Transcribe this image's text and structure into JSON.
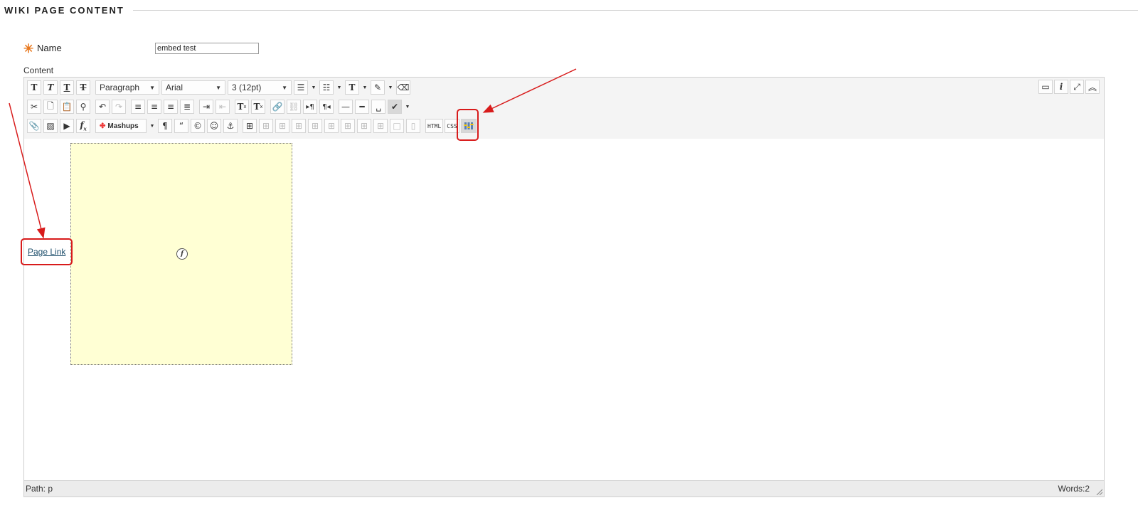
{
  "section": {
    "title": "WIKI PAGE CONTENT"
  },
  "form": {
    "name_label": "Name",
    "name_value": "embed test",
    "content_label": "Content"
  },
  "toolbar": {
    "row1": {
      "bold": "T",
      "italic": "T",
      "underline": "T",
      "strike": "T",
      "format_select": "Paragraph",
      "font_select": "Arial",
      "size_select": "3 (12pt)",
      "text_color": "T"
    },
    "row2": {
      "superscript": "T",
      "superscript_mark": "x",
      "subscript": "T",
      "subscript_mark": "x"
    },
    "row3": {
      "mashups": "Mashups",
      "html": "HTML",
      "css": "CSS"
    }
  },
  "canvas": {
    "page_link": "Page Link"
  },
  "status": {
    "path": "Path: p",
    "words": "Words:2"
  },
  "colors": {
    "accent_required": "#e8781e",
    "annotation": "#d81b1b",
    "embed_background": "#ffffd4",
    "link": "#1d4e6b"
  }
}
